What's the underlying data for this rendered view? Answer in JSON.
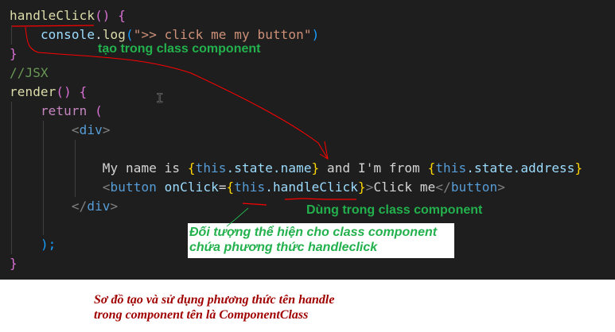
{
  "code": {
    "l1": {
      "name": "handleClick",
      "rest": "() {"
    },
    "l2": {
      "obj": "console",
      "dot": ".",
      "fn": "log",
      "str": "\">> click me my button\""
    },
    "l3": "}",
    "l4": "//JSX",
    "l5": {
      "name": "render",
      "rest": "() {"
    },
    "l6": {
      "kw": "return",
      "paren": "("
    },
    "l7": {
      "tag": "div"
    },
    "l9": {
      "t1": "My name is ",
      "e1": "this",
      "e1b": ".state.name",
      "t2": " and I'm from ",
      "e2": "this",
      "e2b": ".state.address"
    },
    "l10": {
      "tag": "button",
      "attr": "onClick",
      "e": "this",
      "eb": ".handleClick",
      "text": "Click me"
    },
    "l11": {
      "tag": "div"
    },
    "l13": ");",
    "l14": "}"
  },
  "annotations": {
    "create": "tạo trong class component",
    "use": "Dùng trong class component",
    "note_line1": "Đối tượng thể hiện cho class component",
    "note_line2": "chứa phương thức handleclick"
  },
  "caption": {
    "line1": "Sơ đồ tạo và sử dụng phương thức tên handle",
    "line2": "trong component tên là ComponentClass"
  }
}
